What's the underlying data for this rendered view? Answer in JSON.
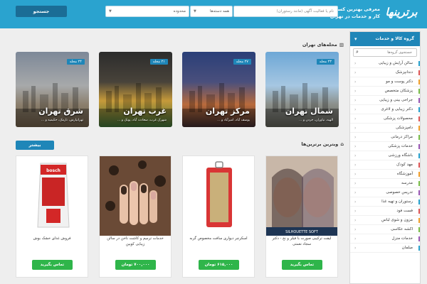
{
  "header": {
    "logo": "برترینها",
    "tagline": "معرفی بهترین کسب و کار و خدمات در تهران",
    "search_placeholder": "نام یا فعالیت آگهی (مانند رستوران)",
    "category_value": "همه دسته‌ها",
    "area_value": "محدوده",
    "search_button": "جستجو"
  },
  "sidebar": {
    "title": "گروه کالا و خدمات",
    "search_placeholder": "جستجوی گروه‌ها",
    "items": [
      {
        "label": "سالن آرایش و زیبایی",
        "mark": "#2aa3cf"
      },
      {
        "label": "دندانپزشک",
        "mark": "#e05858"
      },
      {
        "label": "دکتر پوست و مو",
        "mark": "#f3a12e"
      },
      {
        "label": "پزشکان متخصص",
        "mark": "#7bbf4a"
      },
      {
        "label": "جراحی بینی و زیبایی",
        "mark": "#9b59b6"
      },
      {
        "label": "دکتر زیبایی و لاغری",
        "mark": "#2aa3cf"
      },
      {
        "label": "محصولات پزشکی",
        "mark": "#e05858"
      },
      {
        "label": "دامپزشکی",
        "mark": "#f3a12e"
      },
      {
        "label": "مراکز درمانی",
        "mark": "#7bbf4a"
      },
      {
        "label": "خدمات پزشکی",
        "mark": "#9b59b6"
      },
      {
        "label": "باشگاه ورزشی",
        "mark": "#2aa3cf"
      },
      {
        "label": "مهد کودک",
        "mark": "#e05858"
      },
      {
        "label": "آموزشگاه",
        "mark": "#f3a12e"
      },
      {
        "label": "مدرسه",
        "mark": "#7bbf4a"
      },
      {
        "label": "تدریس خصوصی",
        "mark": "#9b59b6"
      },
      {
        "label": "رستوران و تهیه غذا",
        "mark": "#2aa3cf"
      },
      {
        "label": "فست فود",
        "mark": "#e05858"
      },
      {
        "label": "مزون و شوی لباس",
        "mark": "#f3a12e"
      },
      {
        "label": "اکشه عکاسی",
        "mark": "#7bbf4a"
      },
      {
        "label": "خدمات منزل",
        "mark": "#9b59b6"
      },
      {
        "label": "مبلمان",
        "mark": "#2aa3cf"
      }
    ]
  },
  "areas": {
    "title": "محله‌های تهران",
    "cards": [
      {
        "name": "شمال تهران",
        "count": "۲۳ محله",
        "sub": "الهیه، نیاوران، جردن و ...",
        "bg": "linear-gradient(180deg,#6da7d6 0%,#a6c7e2 45%,#8b8f8a 70%,#5b5a52 100%)"
      },
      {
        "name": "مرکز تهران",
        "count": "۲۷ محله",
        "sub": "یوسف آباد، امیرآباد و ...",
        "bg": "linear-gradient(180deg,#2a3f78 0%,#4a4f7c 40%,#b96b3c 70%,#3b2a2c 100%)"
      },
      {
        "name": "غرب تهران",
        "count": "۲۱ محله",
        "sub": "شهرک غرب، سعادت آباد، پونک و ...",
        "bg": "linear-gradient(180deg,#2c2c2c 0%,#48433a 40%,#c69a3a 65%,#3a6a35 100%)"
      },
      {
        "name": "شرق تهران",
        "count": "۲۴ محله",
        "sub": "تهرانپارس، نارمک، حکیمیه و ...",
        "bg": "linear-gradient(180deg,#7d8898 0%,#a7a9aa 45%,#8b7f6d 70%,#6a5a45 100%)"
      }
    ]
  },
  "showcase": {
    "title": "ویترین برترین‌ها",
    "more_button": "بیشتر",
    "products": [
      {
        "title": "لیفت ترکیبی صورت با فیلر و نخ - دکتر سجاد نعمتی",
        "button": "تماس بگیرید",
        "brand": "SILHOUETTE SOFT"
      },
      {
        "title": "اسکرچر دیواری سافت مخصوص گربه",
        "button": "۶۱۵,۰۰۰ تومان"
      },
      {
        "title": "خدمات ترمیم و کاشت ناخن در سالن زیبایی کوبین",
        "button": "۷۰۰,۰۰۰ تومان"
      },
      {
        "title": "فروش غذای خشک بوش",
        "button": "تماس بگیرید",
        "brand": "bosch"
      }
    ]
  }
}
